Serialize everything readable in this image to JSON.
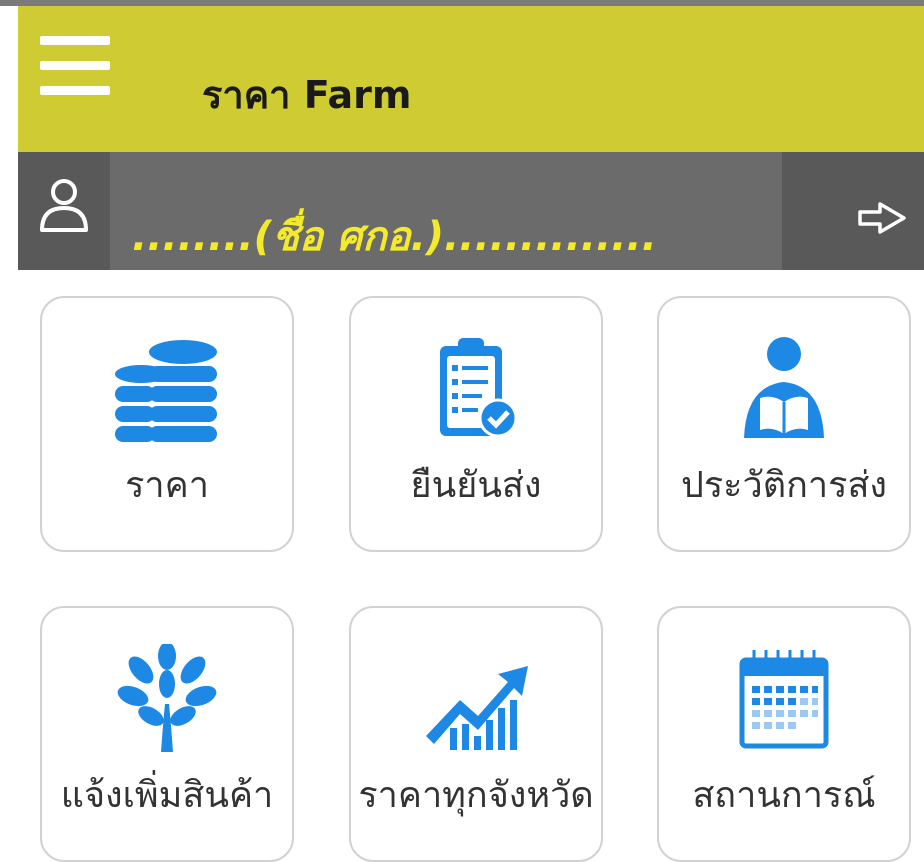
{
  "header": {
    "title": "ราคา Farm",
    "menu_icon": "hamburger-menu-icon"
  },
  "user": {
    "name": "........(ชื่อ ศกอ.)..............",
    "avatar_icon": "user-icon",
    "logout_icon": "logout-arrow-icon"
  },
  "tiles": [
    {
      "label": "ราคา",
      "icon": "coins-stack-icon"
    },
    {
      "label": "ยืนยันส่ง",
      "icon": "clipboard-check-icon"
    },
    {
      "label": "ประวัติการส่ง",
      "icon": "person-reading-icon"
    },
    {
      "label": "แจ้งเพิ่มสินค้า",
      "icon": "tree-icon"
    },
    {
      "label": "ราคาทุกจังหวัด",
      "icon": "trending-up-chart-icon"
    },
    {
      "label": "สถานการณ์",
      "icon": "calendar-icon"
    }
  ],
  "colors": {
    "appbar": "#cfcc33",
    "userbar": "#6b6b6b",
    "username": "#f3ea2c",
    "icon_blue": "#1e88e5"
  }
}
